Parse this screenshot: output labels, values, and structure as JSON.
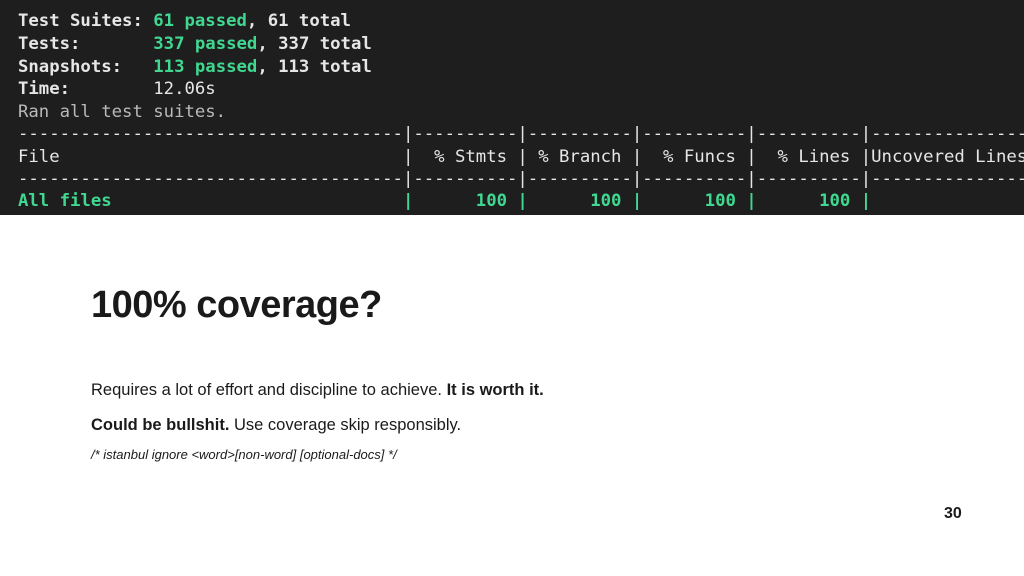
{
  "terminal": {
    "summary": {
      "test_suites": {
        "label": "Test Suites:",
        "passed": "61 passed",
        "rest": ", 61 total"
      },
      "tests": {
        "label": "Tests:",
        "passed": "337 passed",
        "rest": ", 337 total"
      },
      "snapshots": {
        "label": "Snapshots:",
        "passed": "113 passed",
        "rest": ", 113 total"
      },
      "time": {
        "label": "Time:",
        "value": "12.06s"
      },
      "ran": "Ran all test suites."
    },
    "separator_line": "-------------------------------------|----------|----------|----------|----------|----------------|",
    "header_line": "File                                 |  % Stmts | % Branch |  % Funcs |  % Lines |Uncovered Lines |",
    "all_files_name": "All files",
    "all_files_row_rest": "                            |      100 |      100 |      100 |      100 |                |",
    "coverage": {
      "file": "All files",
      "stmts": "100",
      "branch": "100",
      "funcs": "100",
      "lines": "100",
      "uncovered": ""
    },
    "colors": {
      "background": "#1e1e1e",
      "green": "#40d890",
      "text": "#e6e6e6"
    }
  },
  "slide": {
    "title": "100% coverage?",
    "line1_normal": "Requires a lot of effort and discipline to achieve. ",
    "line1_bold": "It is worth it.",
    "line2_bold": "Could be bullshit.",
    "line2_normal": " Use coverage skip responsibly.",
    "line3": "/* istanbul ignore <word>[non-word] [optional-docs] */",
    "page_number": "30"
  }
}
